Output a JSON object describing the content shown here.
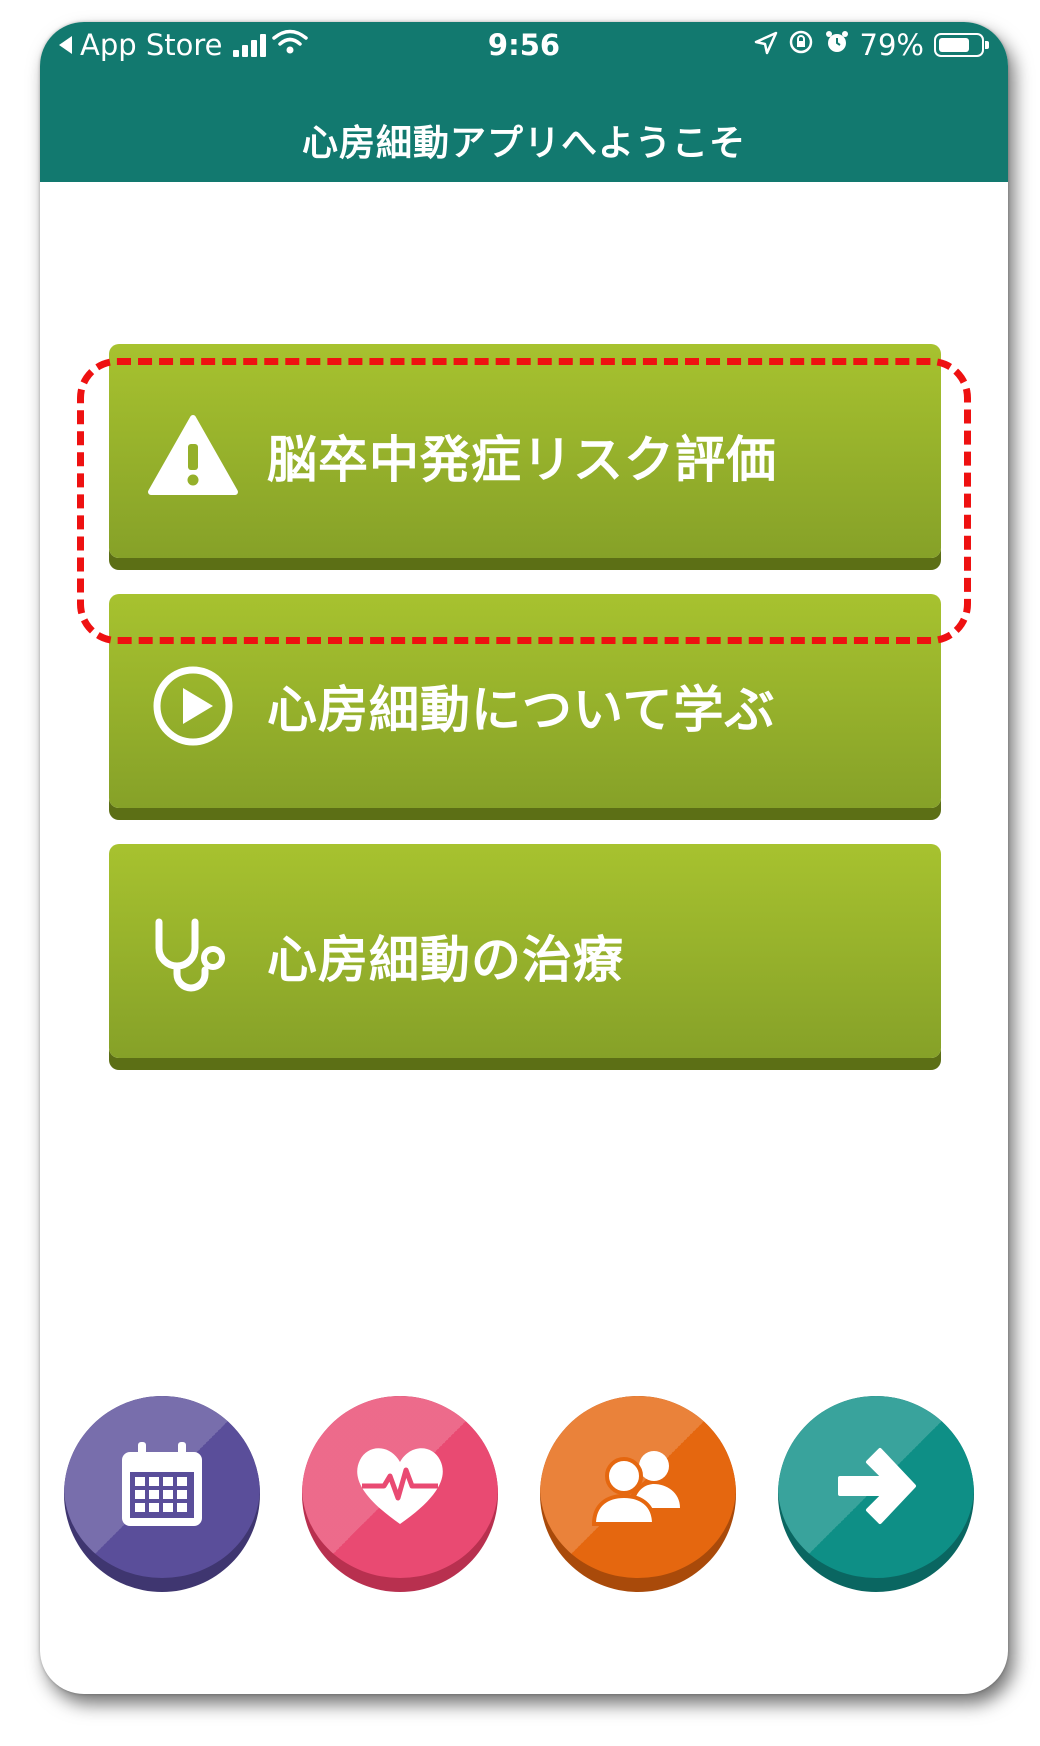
{
  "status_bar": {
    "back_label": "App Store",
    "time": "9:56",
    "battery_percent": "79%",
    "battery_level": 0.79
  },
  "header": {
    "title": "心房細動アプリへようこそ"
  },
  "menu": [
    {
      "label": "脳卒中発症リスク評価",
      "icon": "warning-icon",
      "highlighted": true
    },
    {
      "label": "心房細動について学ぶ",
      "icon": "play-icon",
      "highlighted": false
    },
    {
      "label": "心房細動の治療",
      "icon": "stethoscope-icon",
      "highlighted": false
    }
  ],
  "bottom_nav": [
    {
      "icon": "calendar-icon",
      "color": "#5a4e9a"
    },
    {
      "icon": "heart-pulse-icon",
      "color": "#e94a72"
    },
    {
      "icon": "people-icon",
      "color": "#e5670f"
    },
    {
      "icon": "arrow-right-icon",
      "color": "#0e8f86"
    }
  ],
  "colors": {
    "header_bg": "#12796f",
    "button_green": "#99b52c",
    "highlight_border": "#ee1111"
  }
}
